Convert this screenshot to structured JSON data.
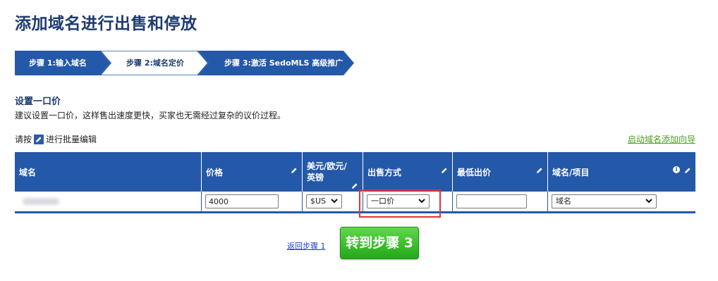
{
  "page": {
    "title": "添加域名进行出售和停放"
  },
  "steps": [
    {
      "label": "步骤 1:输入域名",
      "state": "completed"
    },
    {
      "label": "步骤 2:域名定价",
      "state": "active"
    },
    {
      "label": "步骤 3:激活 SedoMLS 高级推广",
      "state": "upcoming"
    }
  ],
  "section": {
    "title": "设置一口价",
    "description": "建议设置一口价，这样售出速度更快，买家也无需经过复杂的议价过程。"
  },
  "bulk_edit": {
    "prefix": "请按",
    "suffix": "进行批量编辑"
  },
  "wizard_link": "启动域名添加向导",
  "table": {
    "headers": [
      "域名",
      "价格",
      "美元/欧元/英镑",
      "出售方式",
      "最低出价",
      "域名/项目"
    ],
    "row": {
      "price": "4000",
      "currency": "$US",
      "sale_method": "一口价",
      "min_offer": "",
      "category": "域名"
    }
  },
  "footer": {
    "back_link": "返回步骤 1",
    "next_button": "转到步骤 3"
  },
  "colors": {
    "brand_blue": "#2458a8",
    "title_navy": "#1d3b6e",
    "link_green": "#4a9e1e",
    "button_green": "#23a81a",
    "highlight_red": "#e0323b"
  }
}
